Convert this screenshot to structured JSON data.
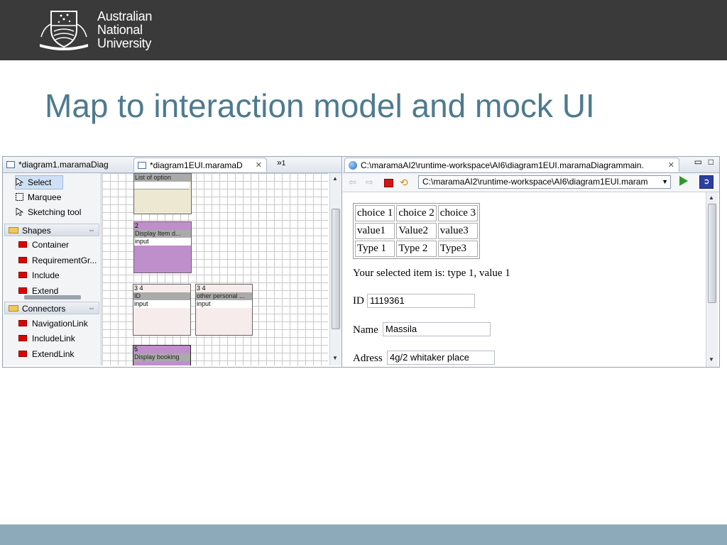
{
  "header": {
    "logo_lines": [
      "Australian",
      "National",
      "University"
    ]
  },
  "slide_title": "Map to interaction model and mock UI",
  "editor": {
    "tabs": [
      {
        "label": "*diagram1.maramaDiag"
      },
      {
        "label": "*diagram1EUI.maramaD"
      }
    ],
    "overflow_count": "1",
    "palette": {
      "tools": [
        "Select",
        "Marquee",
        "Sketching tool"
      ],
      "shapes_label": "Shapes",
      "shapes": [
        "Container",
        "RequirementGr...",
        "Include",
        "Extend"
      ],
      "connectors_label": "Connectors",
      "connectors": [
        "NavigationLink",
        "IncludeLink",
        "ExtendLink"
      ]
    },
    "nodes": [
      {
        "header": "List of option"
      },
      {
        "num": "2",
        "header": "Display Item d...",
        "input": "input"
      },
      {
        "num": "3 4",
        "header": "ID",
        "input": "input"
      },
      {
        "num": "3 4",
        "header": "other personal ...",
        "input": "input"
      },
      {
        "num": "5",
        "header": "Display booking"
      }
    ]
  },
  "browser": {
    "tab_title": "C:\\maramaAI2\\runtime-workspace\\AI6\\diagram1EUI.maramaDiagrammain.",
    "url": "C:\\maramaAI2\\runtime-workspace\\AI6\\diagram1EUI.maram",
    "table": [
      [
        "choice 1",
        "choice 2",
        "choice 3"
      ],
      [
        "value1",
        "Value2",
        "value3"
      ],
      [
        "Type 1",
        "Type 2",
        "Type3"
      ]
    ],
    "selected_text": "Your selected item is: type 1, value 1",
    "fields": {
      "id_label": "ID",
      "id_value": "1119361",
      "name_label": "Name",
      "name_value": "Massila",
      "address_label": "Adress",
      "address_value": "4g/2 whitaker place"
    }
  },
  "colors": {
    "title": "#4e7a8e",
    "topbar": "#3a3a3a",
    "bottom_bar": "#8daaba",
    "node_lavender": "#bf8fcb",
    "node_beige": "#ece8d2",
    "node_pink": "#f6ecec"
  }
}
